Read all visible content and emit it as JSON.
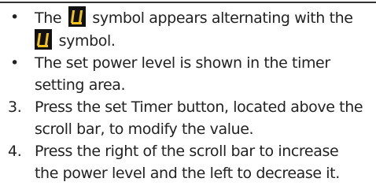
{
  "bullet_mark": "•",
  "items": [
    {
      "type": "bullet",
      "text_before_symbol": "The",
      "text_after_symbol": "symbol appears alternating with the",
      "continuation_text": "symbol."
    },
    {
      "type": "bullet",
      "line1": "The set power level is shown in the timer",
      "line2": "setting area."
    },
    {
      "type": "numbered",
      "number": "3.",
      "line1": "Press the set Timer button, located above the",
      "line2": "scroll bar, to modify the value."
    },
    {
      "type": "numbered",
      "number": "4.",
      "line1": "Press the right of the scroll bar to increase",
      "line2": "the power level and the left to decrease it."
    }
  ],
  "symbol": {
    "icon": "display-symbol-icon",
    "background_color": "#111111",
    "segment_color": "#f2c21b"
  }
}
